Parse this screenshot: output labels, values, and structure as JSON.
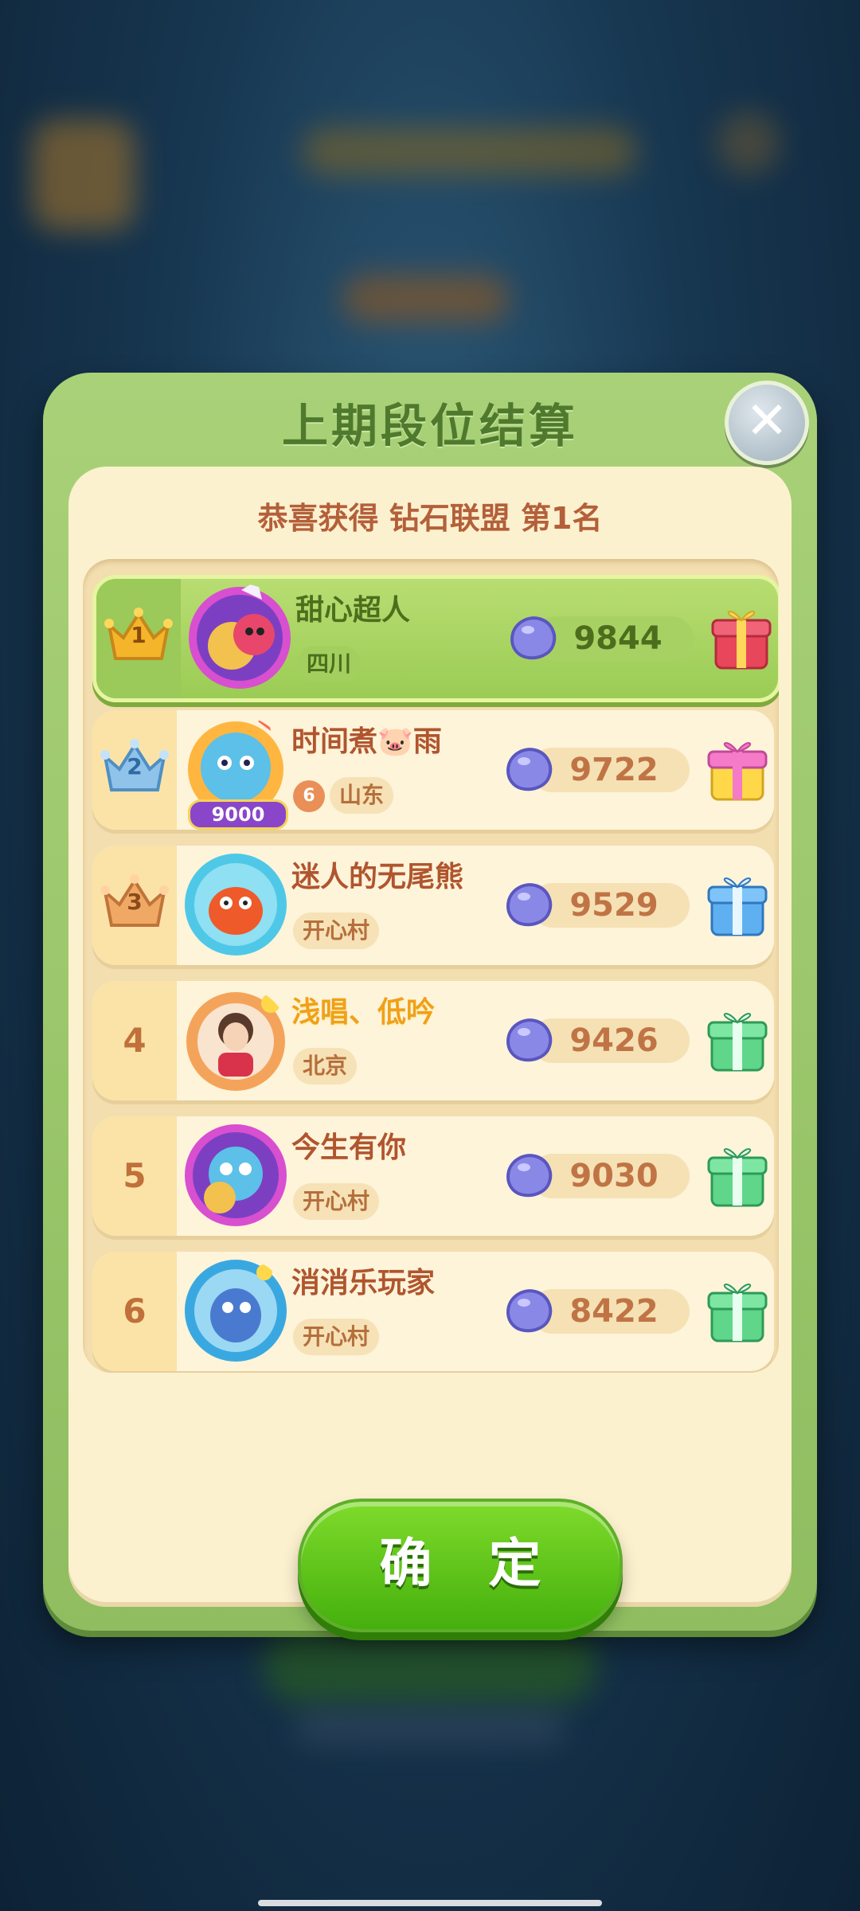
{
  "dialog": {
    "title": "上期段位结算",
    "subtitle": "恭喜获得 钻石联盟 第1名",
    "close_symbol": "✕",
    "confirm_label": "确 定"
  },
  "ranking": [
    {
      "rank": "1",
      "name": "甜心超人",
      "location": "四川",
      "score": "9844",
      "crown": "gold",
      "gift": "red-gift-icon",
      "highlight": true
    },
    {
      "rank": "2",
      "name": "时间煮🐷雨",
      "location": "山东",
      "level": "6",
      "avatar_badge": "9000",
      "score": "9722",
      "crown": "blue",
      "gift": "pink-gift-icon"
    },
    {
      "rank": "3",
      "name": "迷人的无尾熊",
      "location": "开心村",
      "score": "9529",
      "crown": "bronze",
      "gift": "blue-gift-icon"
    },
    {
      "rank": "4",
      "name": "浅唱、低吟",
      "location": "北京",
      "score": "9426",
      "gift": "green-gift-icon"
    },
    {
      "rank": "5",
      "name": "今生有你",
      "location": "开心村",
      "score": "9030",
      "gift": "green-gift-icon"
    },
    {
      "rank": "6",
      "name": "消消乐玩家",
      "location": "开心村",
      "score": "8422",
      "gift": "green-gift-icon"
    }
  ],
  "colors": {
    "dialog_green": "#9ac768",
    "panel_cream": "#fcf1cf",
    "text_brown": "#b0552e",
    "confirm_green": "#55c21a",
    "gem_purple": "#8a88e6"
  }
}
